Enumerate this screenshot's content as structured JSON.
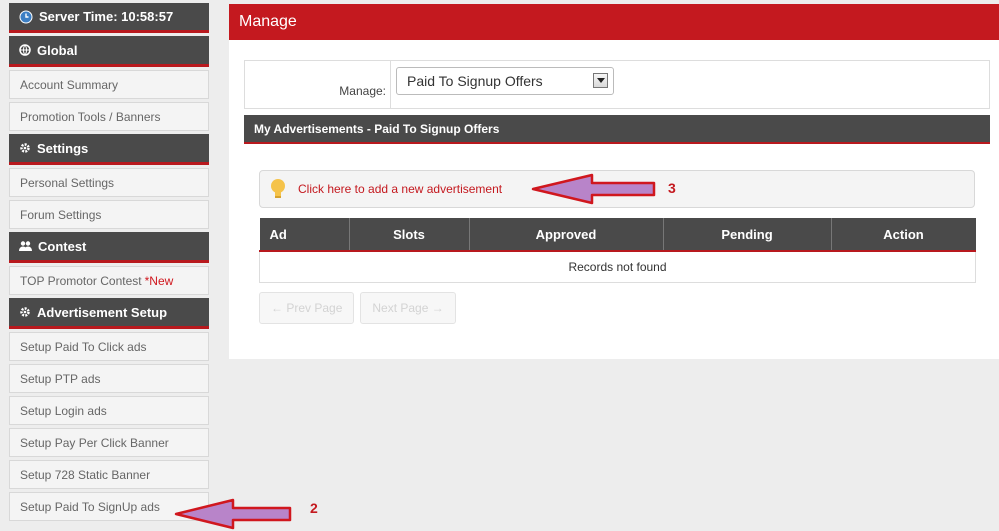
{
  "sidebar": {
    "server_time": "Server Time: 10:58:57",
    "sections": [
      {
        "title": "Global",
        "items": [
          "Account Summary",
          "Promotion Tools / Banners"
        ]
      },
      {
        "title": "Settings",
        "items": [
          "Personal Settings",
          "Forum Settings"
        ]
      },
      {
        "title": "Contest",
        "items": [
          "TOP Promotor Contest"
        ],
        "new_badge": "*New"
      },
      {
        "title": "Advertisement Setup",
        "items": [
          "Setup Paid To Click ads",
          "Setup PTP ads",
          "Setup Login ads",
          "Setup Pay Per Click Banner",
          "Setup 728 Static Banner",
          "Setup Paid To SignUp ads"
        ]
      }
    ]
  },
  "main": {
    "title": "Manage",
    "manage_label": "Manage:",
    "manage_value": "Paid To Signup Offers",
    "subheader": "My Advertisements - Paid To Signup Offers",
    "add_link": "Click here to add a new advertisement",
    "table": {
      "columns": [
        "Ad",
        "Slots",
        "Approved",
        "Pending",
        "Action"
      ],
      "empty": "Records not found"
    },
    "pager": {
      "prev": "← Prev Page",
      "next": "Next Page →"
    }
  },
  "annotations": {
    "a2": "2",
    "a3": "3"
  },
  "colors": {
    "accent": "#c4191f",
    "dark": "#4a4a4a"
  }
}
